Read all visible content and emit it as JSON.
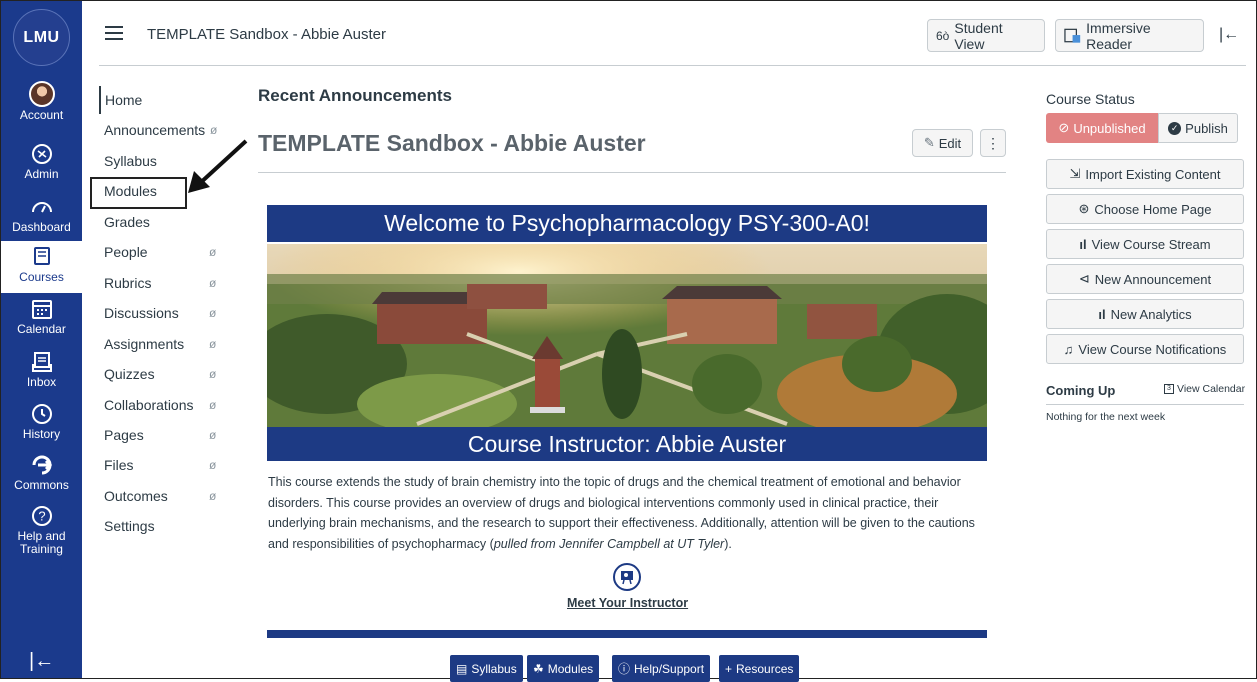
{
  "global_nav": {
    "logo_text": "LMU",
    "items": [
      {
        "label": "Account",
        "icon": "avatar"
      },
      {
        "label": "Admin",
        "icon": "shield-icon"
      },
      {
        "label": "Dashboard",
        "icon": "dashboard-icon"
      },
      {
        "label": "Courses",
        "icon": "book-icon"
      },
      {
        "label": "Calendar",
        "icon": "calendar-icon"
      },
      {
        "label": "Inbox",
        "icon": "inbox-icon"
      },
      {
        "label": "History",
        "icon": "clock-icon"
      },
      {
        "label": "Commons",
        "icon": "commons-icon"
      },
      {
        "label": "Help and Training",
        "icon": "help-icon"
      }
    ],
    "collapse_glyph": "|←",
    "bg_color": "#1b3a8c"
  },
  "header": {
    "breadcrumb": "TEMPLATE Sandbox - Abbie Auster",
    "student_view_label": "Student View",
    "immersive_reader_label": "Immersive Reader",
    "collapse_glyph": "|←"
  },
  "course_nav": {
    "items": [
      {
        "label": "Home",
        "hidden": false
      },
      {
        "label": "Announcements",
        "hidden": true
      },
      {
        "label": "Syllabus",
        "hidden": false
      },
      {
        "label": "Modules",
        "hidden": false
      },
      {
        "label": "Grades",
        "hidden": false
      },
      {
        "label": "People",
        "hidden": true
      },
      {
        "label": "Rubrics",
        "hidden": true
      },
      {
        "label": "Discussions",
        "hidden": true
      },
      {
        "label": "Assignments",
        "hidden": true
      },
      {
        "label": "Quizzes",
        "hidden": true
      },
      {
        "label": "Collaborations",
        "hidden": true
      },
      {
        "label": "Pages",
        "hidden": true
      },
      {
        "label": "Files",
        "hidden": true
      },
      {
        "label": "Outcomes",
        "hidden": true
      },
      {
        "label": "Settings",
        "hidden": false
      }
    ]
  },
  "main": {
    "recent_heading": "Recent Announcements",
    "course_title": "TEMPLATE Sandbox - Abbie Auster",
    "edit_label": "Edit",
    "more_glyph": "⋮",
    "welcome_banner": "Welcome to Psychopharmacology PSY-300-A0!",
    "instructor_banner": "Course Instructor: Abbie Auster",
    "description_main": "This course extends the study of brain chemistry into the topic of drugs and the chemical treatment of emotional and behavior disorders. This course provides an overview of drugs and biological interventions commonly used in clinical practice, their underlying brain mechanisms, and the research to support their effectiveness. Additionally, attention will be given to the cautions and responsibilities of psychopharmacy (",
    "description_italic": "pulled from Jennifer Campbell at UT Tyler",
    "description_end": ").",
    "meet_instructor_label": "Meet Your Instructor",
    "quick_buttons": [
      {
        "label": "Syllabus",
        "icon": "syllabus-icon"
      },
      {
        "label": "Modules",
        "icon": "modules-icon"
      },
      {
        "label": "Help/Support",
        "icon": "help-icon"
      },
      {
        "label": "Resources",
        "icon": "plus-icon"
      }
    ],
    "banner_color": "#1d3a84"
  },
  "sidebar": {
    "status_heading": "Course Status",
    "unpublished_label": "Unpublished",
    "publish_label": "Publish",
    "actions": [
      {
        "label": "Import Existing Content",
        "icon": "import-icon"
      },
      {
        "label": "Choose Home Page",
        "icon": "home-page-icon"
      },
      {
        "label": "View Course Stream",
        "icon": "bar-chart-icon"
      },
      {
        "label": "New Announcement",
        "icon": "megaphone-icon"
      },
      {
        "label": "New Analytics",
        "icon": "bar-chart-icon"
      },
      {
        "label": "View Course Notifications",
        "icon": "bell-icon"
      }
    ],
    "coming_up_heading": "Coming Up",
    "view_calendar_label": "View Calendar",
    "nothing_text": "Nothing for the next week",
    "unpublished_color": "#e28383"
  }
}
